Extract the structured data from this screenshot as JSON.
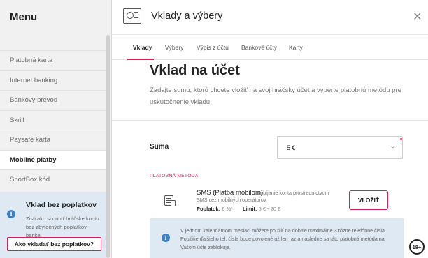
{
  "sidebar": {
    "title": "Menu",
    "items": [
      {
        "label": "Platobná karta"
      },
      {
        "label": "Internet banking"
      },
      {
        "label": "Bankový prevod"
      },
      {
        "label": "Skrill"
      },
      {
        "label": "Paysafe karta"
      },
      {
        "label": "Mobilné platby"
      },
      {
        "label": "SportBox kód"
      }
    ],
    "active_item": "Mobilné platby",
    "promo": {
      "title": "Vklad bez poplatkov",
      "text": "Zisti ako si dobiť hráčske konto bez zbytočných poplatkov banke.",
      "button": "Ako vkladať bez poplatkov?"
    }
  },
  "header": {
    "title": "Vklady a výbery",
    "close_icon": "close-icon",
    "wallet_icon": "wallet-icon"
  },
  "tabs": [
    {
      "label": "Vklady",
      "active": true
    },
    {
      "label": "Výbery",
      "active": false
    },
    {
      "label": "Výpis z účtu",
      "active": false
    },
    {
      "label": "Bankové účty",
      "active": false
    },
    {
      "label": "Karty",
      "active": false
    }
  ],
  "main": {
    "heading": "Vklad na účet",
    "description": "Zadajte sumu, ktorú chcete vložiť na svoj hráčsky účet a vyberte platobnú metódu pre uskutočnenie vkladu.",
    "amount_label": "Suma",
    "amount_value": "5 €",
    "payment_method_label": "PLATOBNÁ METÓDA",
    "method": {
      "name": "SMS (Platba mobilom)",
      "subtitle_a": "Dobíjanie konta prostredníctvom",
      "subtitle_b": "SMS cez mobilných operátorov.",
      "fee_label": "Poplatok:",
      "fee_value": "6 %*",
      "limit_label": "Limit:",
      "limit_value": "5 € - 20 €",
      "button": "VLOŽIŤ"
    },
    "info_text": "V jednom kalendárnom mesiaci môžete použiť na dobitie maximálne 3 rôzne telefónne čísla. Použitie ďalšieho tel. čísla bude povolené už len raz a následne sa táto platobná metóda na Vašom účte zablokuje."
  },
  "age_badge": "18+",
  "colors": {
    "accent": "#d91e50",
    "info_bg": "#dfe9f4",
    "info_icon": "#3d7fc4"
  }
}
